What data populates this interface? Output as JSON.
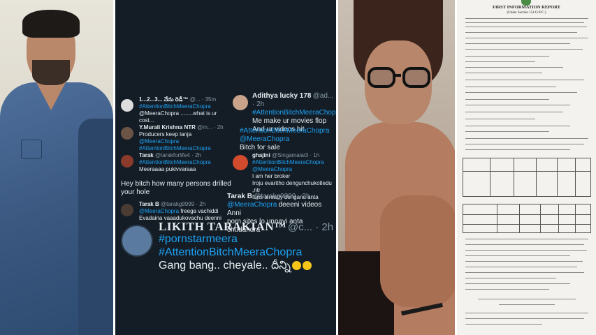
{
  "tweets": [
    {
      "name": "1...2...3... నేను రెడీ™",
      "handle": "@... · 35m",
      "tag": "#AttentionBitchMeeraChopra",
      "text": "@MeeraChopra ........what is ur cost..."
    },
    {
      "name": "Y.Murali Krishna NTR",
      "handle": "@m... · 2h",
      "text": "Producers keep lanja",
      "mention": "@MeeraChopra",
      "tag": "#AttentionBitchMeeraChopra"
    },
    {
      "name": "Tarak",
      "handle": "@tarakforlife4 · 2h",
      "tag": "#AttentionBitchMeeraChopra",
      "text": "Meeraaaa pukivvaraaa"
    },
    {
      "text": "Hey bitch how many persons drilled your hole"
    },
    {
      "name": "Tarak B",
      "handle": "@tarakg9999 · 2h",
      "mention": "@MeeraChopra",
      "text": "freega vachiddi",
      "text2": "Evadaina vaaadukovachu deenni"
    },
    {
      "name": "Adithya lucky 178",
      "handle": "@ad... · 2h",
      "tag": "#AttentionBitchMeeraChopra",
      "text": "Me make ur movies flop",
      "text2": "And ur videos hit"
    },
    {
      "tag": "#AttentionBitchMeeraChopra",
      "mention": "@MeeraChopra",
      "text": "Bitch for sale"
    },
    {
      "name": "ghajini",
      "handle": "@Singamalai3 · 1h",
      "tag": "#AttentionBitchMeeraChopra",
      "mention": "@MeeraChopra",
      "text": "I am her broker",
      "text2": "Iroju evaritho dengunchukotledu ,ntr",
      "text3": "fans already denganu anta"
    },
    {
      "name": "Tarak B",
      "handle": "@tarakg9999 · 2h",
      "mention": "@MeeraChopra",
      "text": "deeeni videos Anni",
      "text2": "porn sites lo unnayi anta chudandra"
    },
    {
      "name": "LIKITH TARAKIAN™",
      "handle": "@c... · 2h",
      "tag": "#pornstarmeera",
      "tag2": "#AttentionBitchMeeraChopra",
      "text": "Gang bang.. cheyale.. దీన్ని"
    }
  ],
  "document": {
    "title": "FIRST INFORMATION REPORT",
    "subtitle": "(Under Section 154 Cr.P.C.)"
  }
}
